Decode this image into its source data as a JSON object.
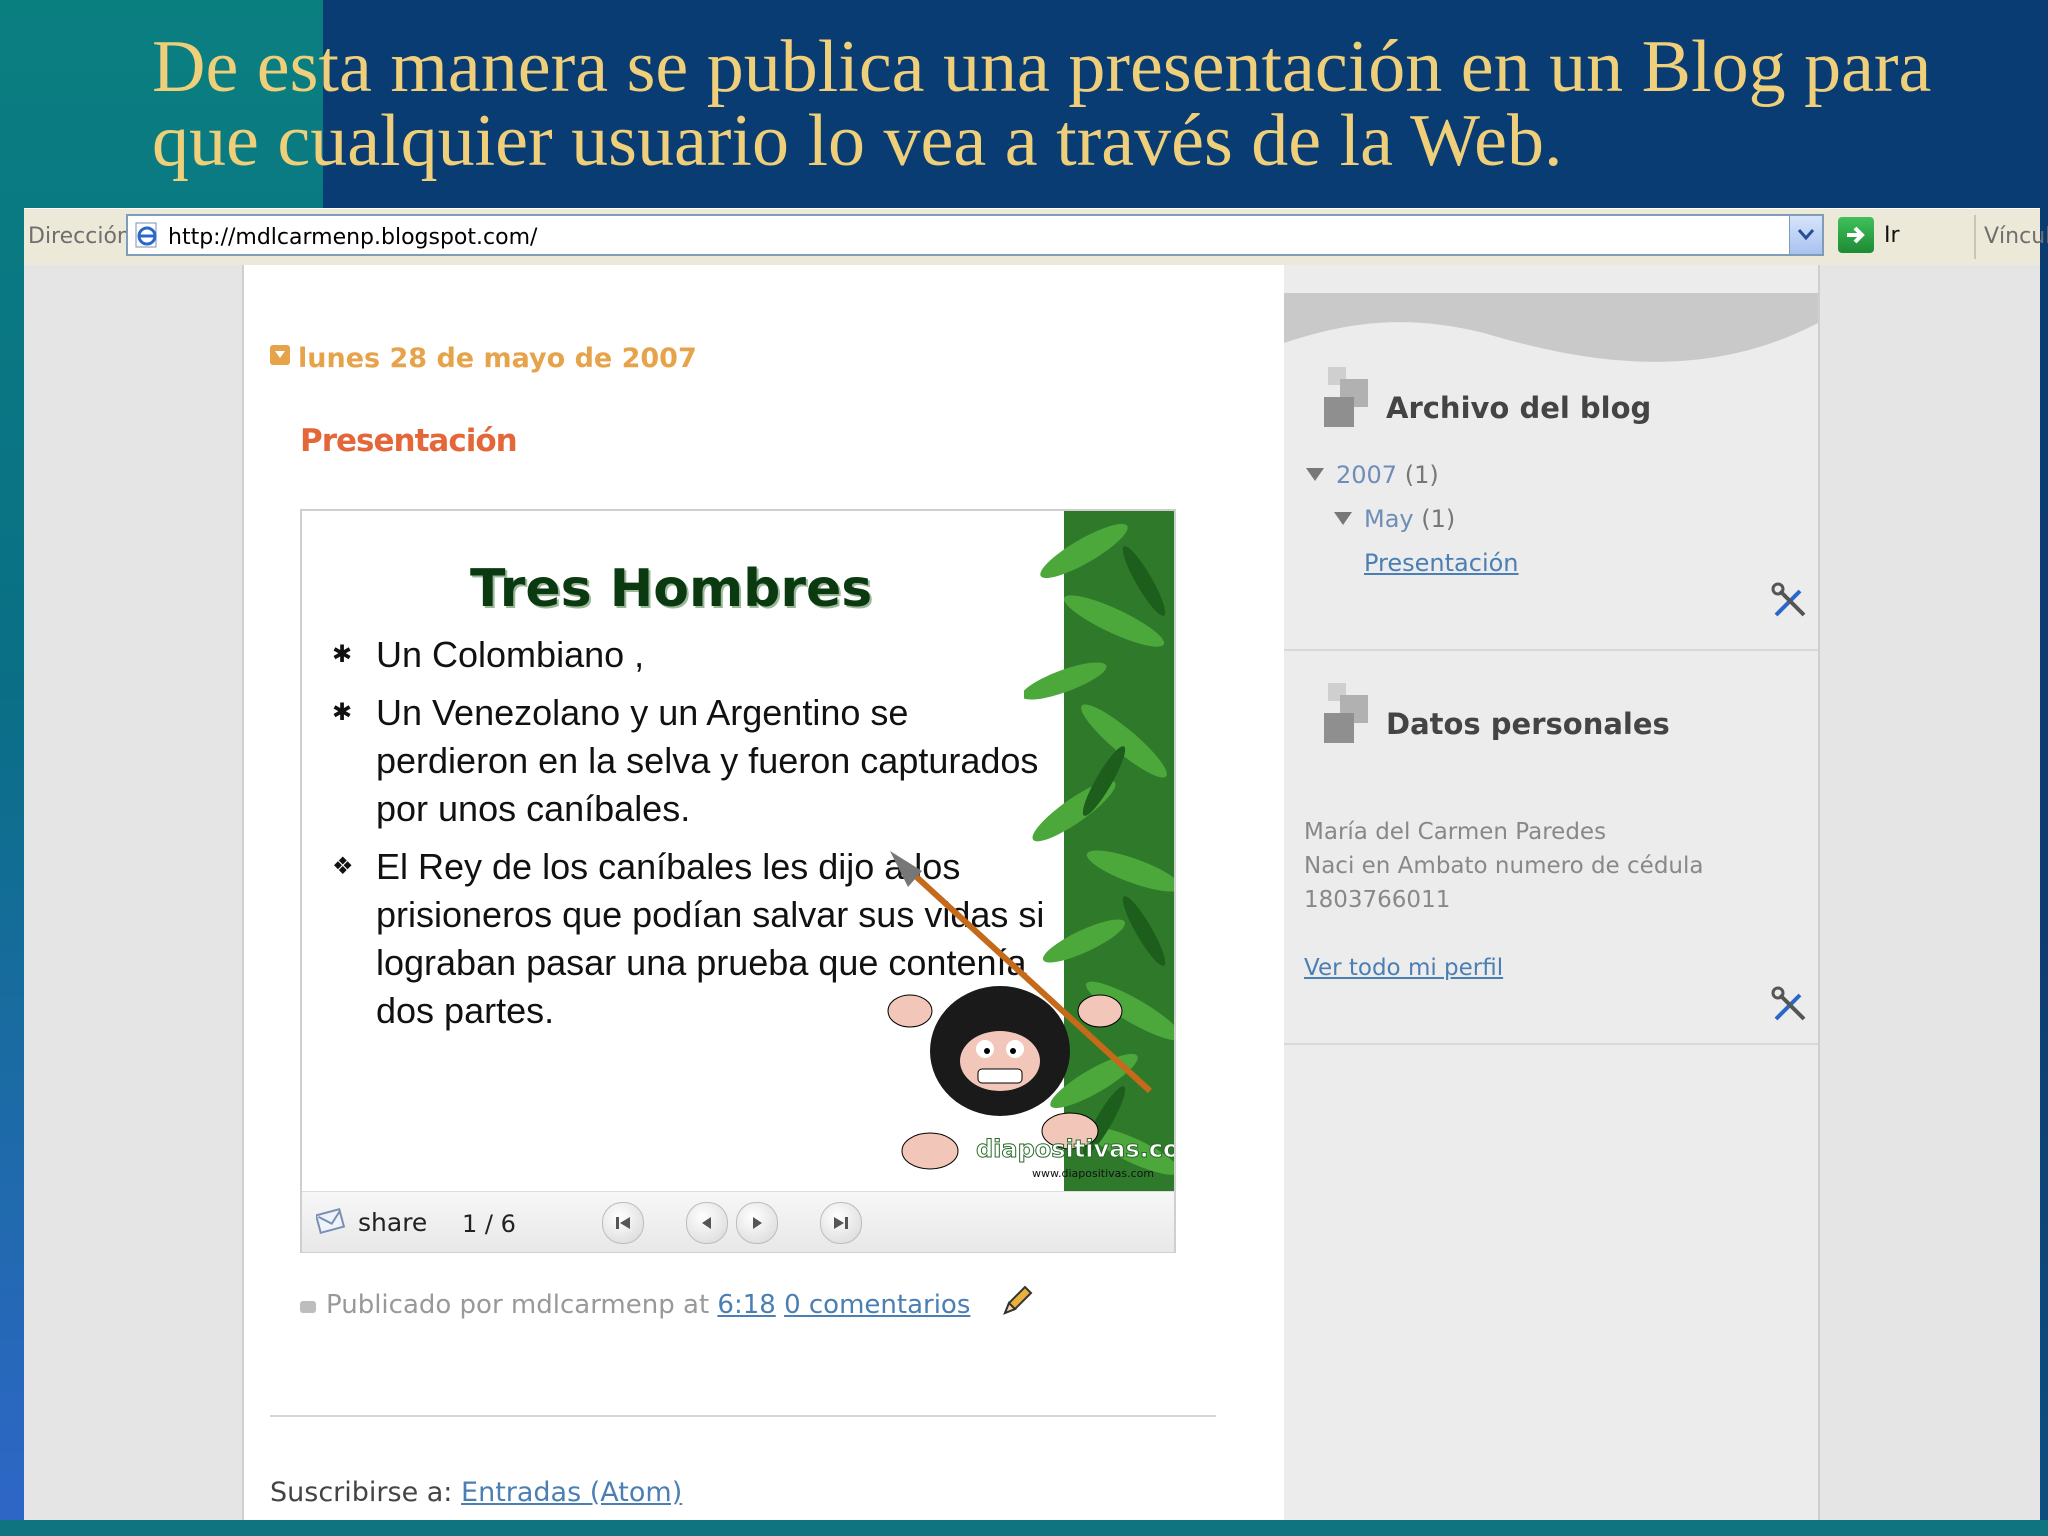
{
  "slide": {
    "title": "De esta manera se publica una presentación en un Blog para que cualquier usuario lo vea a través de la Web."
  },
  "browser": {
    "address_label": "Dirección",
    "url": "http://mdlcarmenp.blogspot.com/",
    "go_label": "Ir",
    "links_label": "Vínculos"
  },
  "blog": {
    "date_header": "lunes 28 de mayo de 2007",
    "post_title": "Presentación",
    "embed": {
      "heading": "Tres Hombres",
      "bullets": [
        "Un Colombiano ,",
        "Un Venezolano y un Argentino se perdieron en la selva y fueron capturados por unos caníbales.",
        "El Rey de los caníbales les dijo a los prisioneros que podían salvar sus vidas si lograban pasar una prueba que contenía dos partes."
      ],
      "watermark": "diapositivas.com",
      "watermark_url": "www.diapositivas.com",
      "share_label": "share",
      "page_indicator": "1 / 6"
    },
    "footer": {
      "published_by": "Publicado por mdlcarmenp at",
      "time": "6:18",
      "comments": "0 comentarios"
    },
    "subscribe_label": "Suscribirse a:",
    "subscribe_link": "Entradas (Atom)"
  },
  "sidebar": {
    "archive": {
      "title": "Archivo del blog",
      "year": "2007",
      "year_count": "(1)",
      "month": "May",
      "month_count": "(1)",
      "post": "Presentación"
    },
    "profile": {
      "title": "Datos personales",
      "name": "María del Carmen Paredes",
      "line2": "Naci en Ambato numero de cédula",
      "line3": "1803766011",
      "link": "Ver todo mi perfil"
    }
  }
}
